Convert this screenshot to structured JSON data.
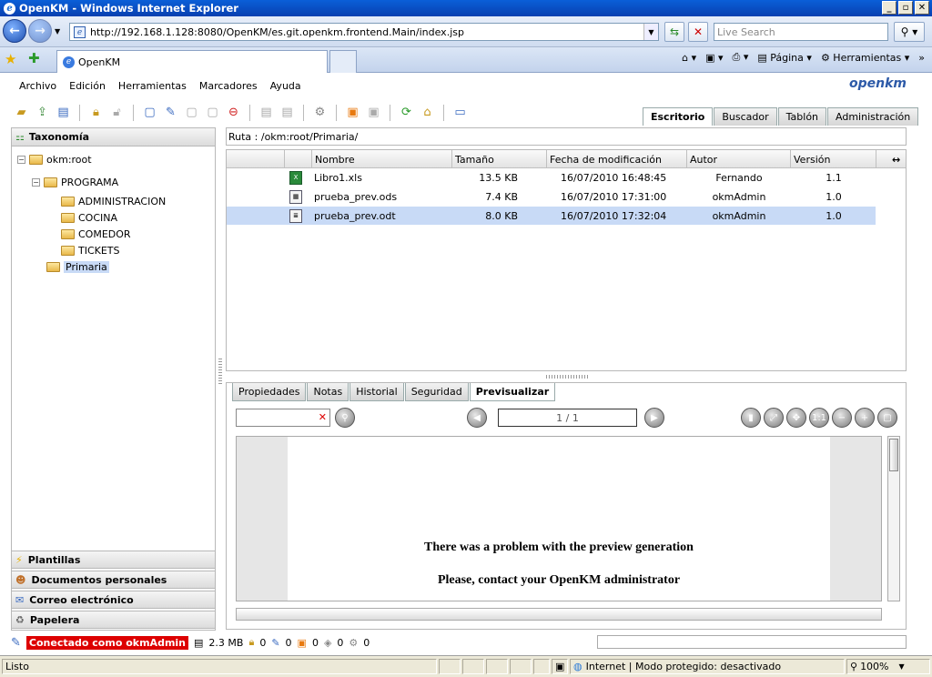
{
  "window": {
    "title": "OpenKM - Windows Internet Explorer"
  },
  "browser": {
    "address": "http://192.168.1.128:8080/OpenKM/es.git.openkm.frontend.Main/index.jsp",
    "search_placeholder": "Live Search",
    "tab_title": "OpenKM",
    "cmd_page": "Página",
    "cmd_tools": "Herramientas"
  },
  "menu": [
    "Archivo",
    "Edición",
    "Herramientas",
    "Marcadores",
    "Ayuda"
  ],
  "logo": "openkm",
  "main_tabs": [
    "Escritorio",
    "Buscador",
    "Tablón",
    "Administración"
  ],
  "left": {
    "header": "Taxonomía",
    "tree": {
      "root": "okm:root",
      "programa": "PROGRAMA",
      "administracion": "ADMINISTRACION",
      "cocina": "COCINA",
      "comedor": "COMEDOR",
      "tickets": "TICKETS",
      "primaria": "Primaria"
    },
    "stacks": [
      "Plantillas",
      "Documentos personales",
      "Correo electrónico",
      "Papelera"
    ]
  },
  "path": "Ruta : /okm:root/Primaria/",
  "files": {
    "columns": {
      "name": "Nombre",
      "size": "Tamaño",
      "date": "Fecha de modificación",
      "author": "Autor",
      "version": "Versión"
    },
    "rows": [
      {
        "name": "Libro1.xls",
        "size": "13.5 KB",
        "date": "16/07/2010 16:48:45",
        "author": "Fernando",
        "version": "1.1"
      },
      {
        "name": "prueba_prev.ods",
        "size": "7.4 KB",
        "date": "16/07/2010 17:31:00",
        "author": "okmAdmin",
        "version": "1.0"
      },
      {
        "name": "prueba_prev.odt",
        "size": "8.0 KB",
        "date": "16/07/2010 17:32:04",
        "author": "okmAdmin",
        "version": "1.0"
      }
    ]
  },
  "bottom_tabs": [
    "Propiedades",
    "Notas",
    "Historial",
    "Seguridad",
    "Previsualizar"
  ],
  "preview": {
    "page": "1 / 1",
    "msg1": "There was a problem with the preview generation",
    "msg2": "Please, contact your OpenKM administrator"
  },
  "app_status": {
    "connected": "Conectado como okmAdmin",
    "size": "2.3 MB",
    "count_locked": "0",
    "count_edit": "0",
    "count_mail": "0",
    "count_sub": "0",
    "count_work": "0"
  },
  "ie_status": {
    "left": "Listo",
    "zone": "Internet | Modo protegido: desactivado",
    "zoom": "100%"
  }
}
